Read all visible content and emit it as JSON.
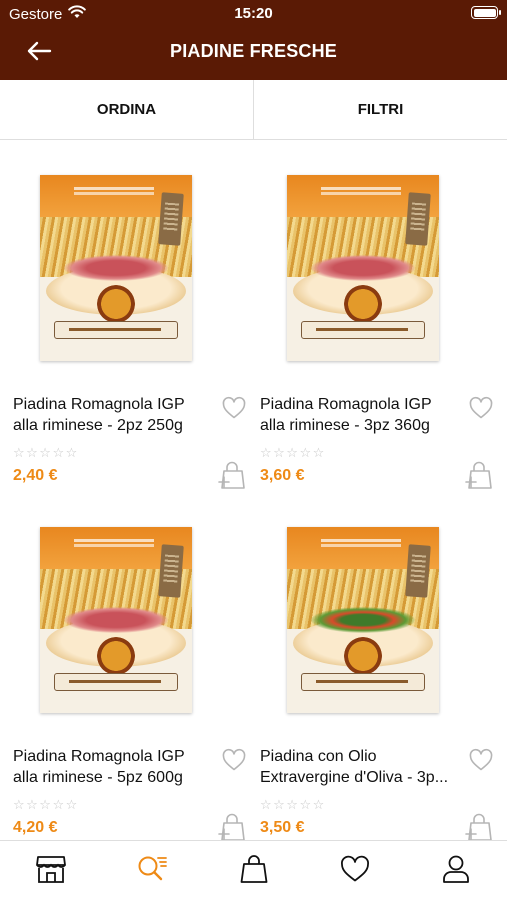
{
  "status_bar": {
    "carrier": "Gestore",
    "time": "15:20"
  },
  "header": {
    "title": "PIADINE FRESCHE",
    "back_icon": "arrow-left-icon"
  },
  "toolbar": {
    "sort_label": "ORDINA",
    "filter_label": "FILTRI"
  },
  "products": [
    {
      "name_line1": "Piadina Romagnola IGP",
      "name_line2": "alla riminese - 2pz 250g",
      "rating": 0,
      "stars": "☆☆☆☆☆",
      "price": "2,40 €"
    },
    {
      "name_line1": "Piadina Romagnola IGP",
      "name_line2": "alla riminese - 3pz 360g",
      "rating": 0,
      "stars": "☆☆☆☆☆",
      "price": "3,60 €"
    },
    {
      "name_line1": "Piadina Romagnola IGP",
      "name_line2": "alla riminese - 5pz 600g",
      "rating": 0,
      "stars": "☆☆☆☆☆",
      "price": "4,20 €"
    },
    {
      "name_line1": "Piadina con Olio",
      "name_line2": "Extravergine d'Oliva - 3p...",
      "rating": 0,
      "stars": "☆☆☆☆☆",
      "price": "3,50 €"
    }
  ],
  "tab_bar": {
    "items": [
      "store-icon",
      "search-list-icon",
      "shopping-bag-icon",
      "heart-icon",
      "user-icon"
    ],
    "active": "search-list-icon"
  },
  "colors": {
    "header_bg": "#5a1a05",
    "price": "#ee8a16",
    "active_tab": "#ee8a16"
  }
}
